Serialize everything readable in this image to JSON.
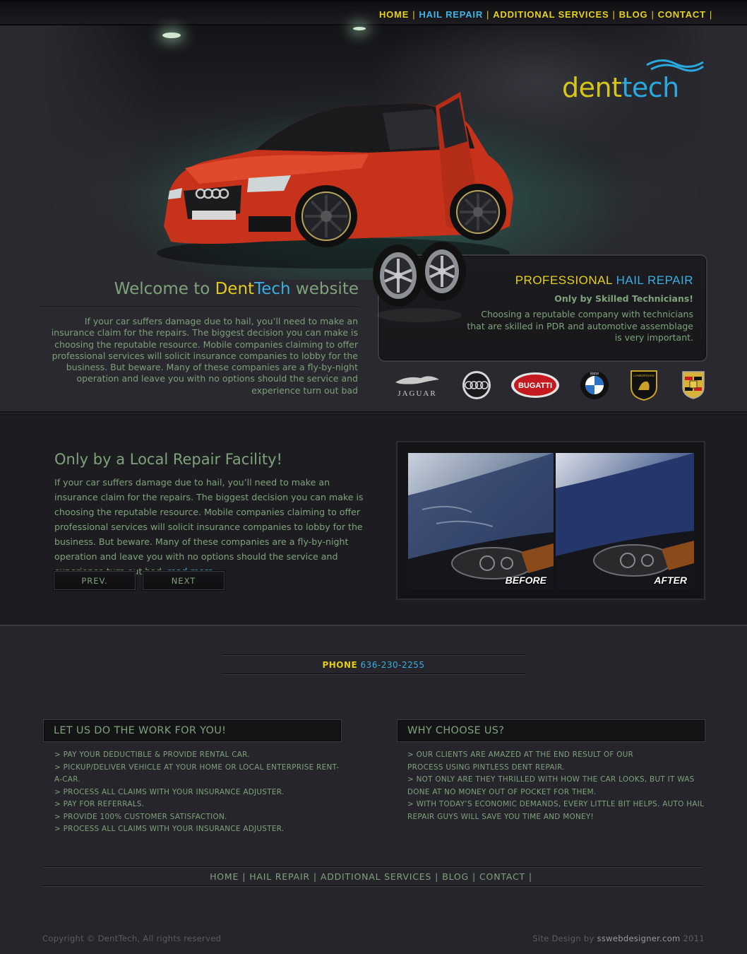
{
  "nav": {
    "items": [
      {
        "label": "HOME",
        "active": false
      },
      {
        "label": "HAIL REPAIR",
        "active": true
      },
      {
        "label": "ADDITIONAL SERVICES",
        "active": false
      },
      {
        "label": "BLOG",
        "active": false
      },
      {
        "label": "CONTACT",
        "active": false
      }
    ],
    "separator": "|"
  },
  "logo": {
    "part1": "dent",
    "part2": "tech"
  },
  "welcome": {
    "title_prefix": "Welcome to ",
    "title_brand1": "Dent",
    "title_brand2": "Tech",
    "title_suffix": " website",
    "body": "If your car suffers damage due to hail, you’ll need to make an insurance claim for the repairs. The biggest decision you can make is choosing the reputable resource. Mobile companies claiming to offer professional services will solicit  insurance companies to lobby for the business. But beware. Many of these companies are a fly-by-night operation and leave you with no options should the service and experience turn out bad"
  },
  "pro": {
    "title1": "PROFESSIONAL ",
    "title2": "HAIL REPAIR",
    "subtitle": "Only by Skilled Technicians!",
    "body": "Choosing a reputable company with technicians that are skilled in PDR and automotive assemblage is very important."
  },
  "brands": {
    "jaguar": "JAGUAR",
    "bugatti": "BUGATTI",
    "bmw": "BMW",
    "lamborghini": "LAMBORGHINI"
  },
  "local": {
    "title": "Only by a Local Repair Facility!",
    "body": "If your car suffers damage due to hail, you’ll need to make an insurance claim for the repairs.  The biggest decision you can make is choosing the reputable resource.  Mobile companies claiming to offer professional services will solicit insurance companies to lobby for the business.  But beware. Many of these companies are a fly-by-night operation and leave you with no options should the service and experience turn out bad.",
    "read_more": "read more",
    "prev": "PREV.",
    "next": "NEXT",
    "before": "BEFORE",
    "after": "AFTER"
  },
  "phone": {
    "label": "PHONE",
    "number": "636-230-2255"
  },
  "work": {
    "title": "LET US DO THE WORK FOR YOU!",
    "items": [
      "> PAY YOUR DEDUCTIBLE & PROVIDE RENTAL CAR.",
      "> PICKUP/DELIVER VEHICLE AT YOUR HOME OR LOCAL ENTERPRISE RENT-A-CAR.",
      "> PROCESS ALL CLAIMS WITH YOUR INSURANCE ADJUSTER.",
      "> PAY FOR REFERRALS.",
      "> PROVIDE 100% CUSTOMER SATISFACTION.",
      "> PROCESS ALL CLAIMS WITH YOUR INSURANCE ADJUSTER."
    ]
  },
  "why": {
    "title": "WHY CHOOSE US?",
    "items": [
      "> OUR CLIENTS ARE AMAZED AT THE END RESULT OF OUR",
      "PROCESS USING PINTLESS DENT REPAIR.",
      "> NOT ONLY ARE THEY THRILLED WITH HOW THE CAR LOOKS, BUT IT WAS",
      "DONE AT NO MONEY OUT OF POCKET FOR THEM.",
      "> WITH TODAY’S ECONOMIC DEMANDS, EVERY LITTLE BIT HELPS. AUTO HAIL",
      "REPAIR GUYS WILL SAVE YOU TIME AND MONEY!"
    ]
  },
  "footer": {
    "copyright": "Copyright © DentTech, All rights reserved",
    "credit_prefix": "Site Design by ",
    "credit_site": "sswebdesigner.com",
    "credit_year": " 2011"
  },
  "colors": {
    "yellow": "#e6d21a",
    "blue": "#3aaee0",
    "green_text": "#7ea27a",
    "background": "#26252b",
    "car_red": "#d4391f"
  }
}
